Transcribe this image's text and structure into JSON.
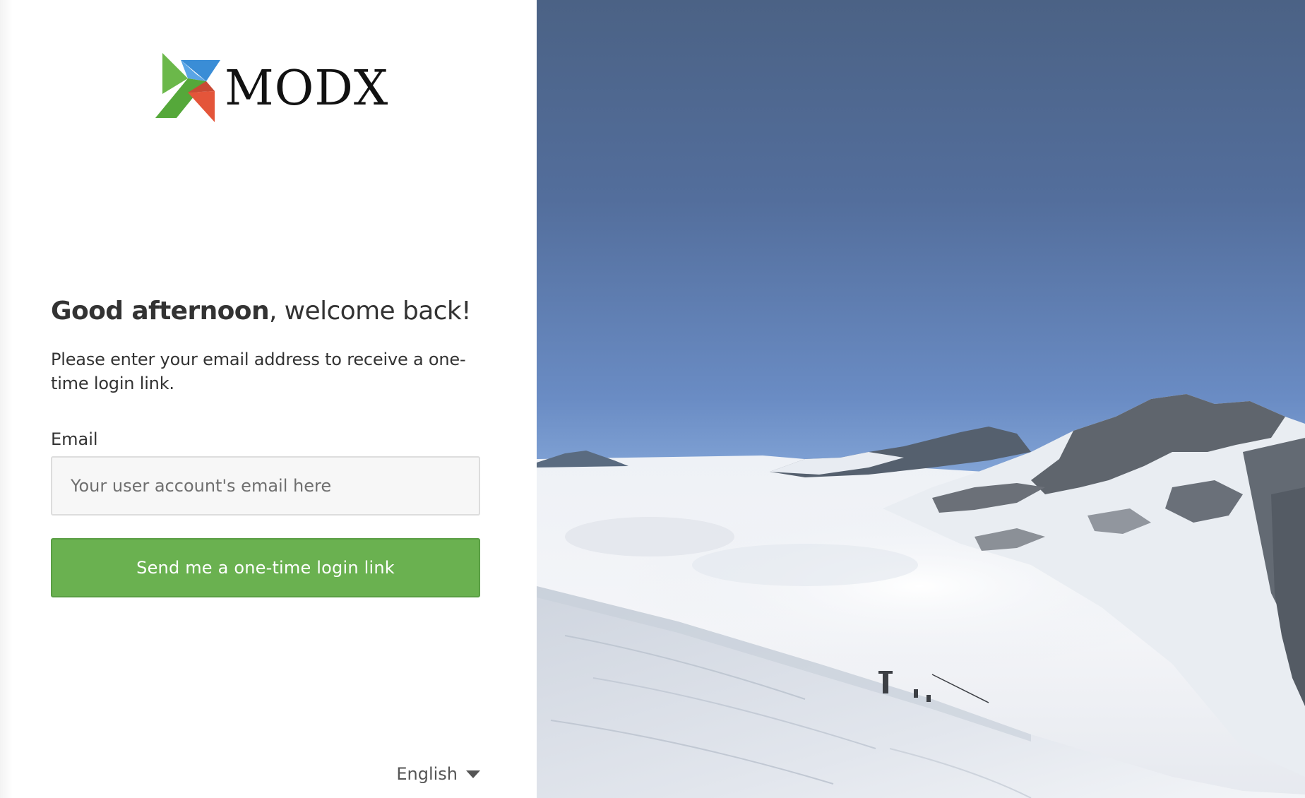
{
  "brand": {
    "name": "MODX",
    "logo_icon": "modx-logo-icon"
  },
  "greeting": {
    "strong": "Good afternoon",
    "rest": ", welcome back!"
  },
  "instructions": "Please enter your email address to receive a one-time login link.",
  "form": {
    "email_label": "Email",
    "email_placeholder": "Your user account's email here",
    "email_value": "",
    "submit_label": "Send me a one-time login link"
  },
  "language": {
    "selected": "English",
    "icon": "caret-down-icon"
  },
  "colors": {
    "button_green": "#6ab150",
    "text": "#333333",
    "logo_blue": "#3a8dd6",
    "logo_green": "#6bb84a",
    "logo_red": "#e4553a"
  },
  "background_image": {
    "icon": "mountain-landscape-image"
  }
}
